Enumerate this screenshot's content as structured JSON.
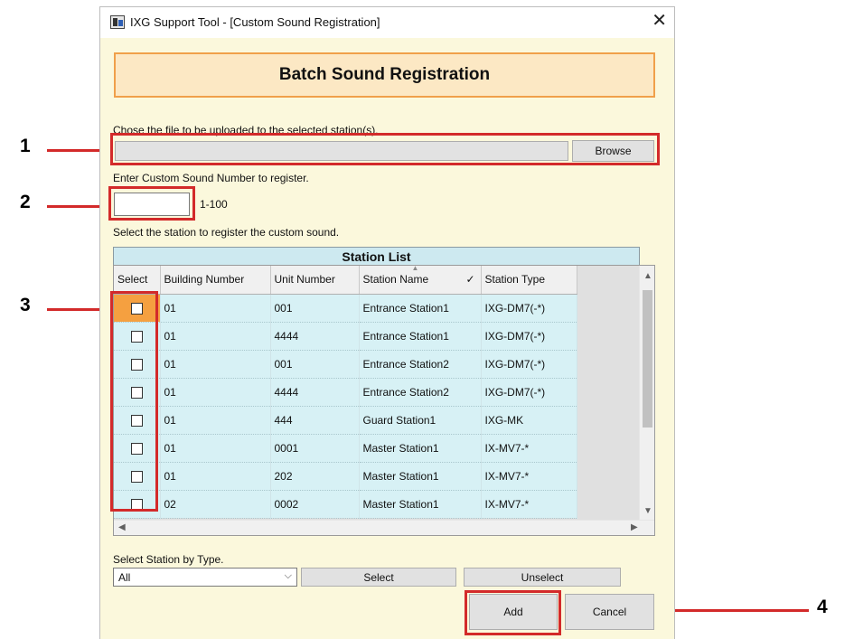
{
  "window": {
    "title": "IXG Support Tool - [Custom Sound Registration]",
    "close_glyph": "✕"
  },
  "header": {
    "title": "Batch Sound Registration"
  },
  "file": {
    "instruction": "Chose the file to be uploaded to the selected station(s).",
    "value": "",
    "browse_label": "Browse"
  },
  "sound_number": {
    "instruction": "Enter Custom Sound Number to register.",
    "value": "",
    "range": "1-100"
  },
  "station": {
    "instruction": "Select the station to register the custom sound.",
    "list_title": "Station List",
    "columns": [
      "Select",
      "Building Number",
      "Unit Number",
      "Station Name",
      "Station Type"
    ],
    "rows": [
      {
        "building": "01",
        "unit": "001",
        "name": "Entrance Station1",
        "type": "IXG-DM7(-*)"
      },
      {
        "building": "01",
        "unit": "4444",
        "name": "Entrance Station1",
        "type": "IXG-DM7(-*)"
      },
      {
        "building": "01",
        "unit": "001",
        "name": "Entrance Station2",
        "type": "IXG-DM7(-*)"
      },
      {
        "building": "01",
        "unit": "4444",
        "name": "Entrance Station2",
        "type": "IXG-DM7(-*)"
      },
      {
        "building": "01",
        "unit": "444",
        "name": "Guard Station1",
        "type": "IXG-MK"
      },
      {
        "building": "01",
        "unit": "0001",
        "name": "Master Station1",
        "type": "IX-MV7-*"
      },
      {
        "building": "01",
        "unit": "202",
        "name": "Master Station1",
        "type": "IX-MV7-*"
      },
      {
        "building": "02",
        "unit": "0002",
        "name": "Master Station1",
        "type": "IX-MV7-*"
      }
    ]
  },
  "select_by_type": {
    "label": "Select Station by Type.",
    "selected": "All",
    "select_label": "Select",
    "unselect_label": "Unselect"
  },
  "actions": {
    "add_label": "Add",
    "cancel_label": "Cancel"
  },
  "callouts": [
    "1",
    "2",
    "3",
    "4"
  ],
  "colors": {
    "highlight": "#d32a2a",
    "header_border": "#f0a04a",
    "row_bg": "#d7f1f5"
  }
}
